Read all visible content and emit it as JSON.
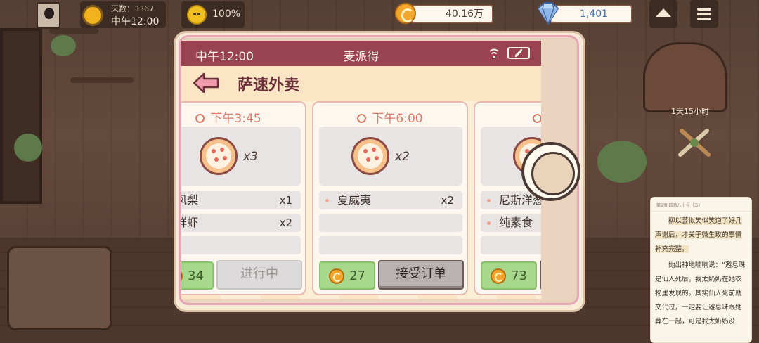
{
  "hud": {
    "day_label": "天数：3367",
    "time_label": "中午12:00",
    "mood_percent": "100%",
    "coins": "40.16万",
    "gems": "1,401"
  },
  "side": {
    "timer_label": "1天15小时"
  },
  "phone": {
    "status_time": "中午12:00",
    "app_title": "麦派得",
    "page_heading": "萨速外卖",
    "orders": [
      {
        "time": "下午3:45",
        "pizza_qty": "x3",
        "items": [
          {
            "name": "凤梨",
            "count": "x1"
          },
          {
            "name": "鲜虾",
            "count": "x2"
          }
        ],
        "reward": "34",
        "action": "进行中",
        "action_state": "in-progress"
      },
      {
        "time": "下午6:00",
        "pizza_qty": "x2",
        "items": [
          {
            "name": "夏威夷",
            "count": "x2"
          }
        ],
        "reward": "27",
        "action": "接受订单",
        "action_state": "available"
      },
      {
        "time": "下午",
        "pizza_qty": "",
        "items": [
          {
            "name": "尼斯洋葱",
            "count": ""
          },
          {
            "name": "纯素食",
            "count": ""
          }
        ],
        "reward": "73",
        "action": "",
        "action_state": "available"
      }
    ]
  },
  "reader": {
    "header": "第2页 四章八十号（五）",
    "paragraphs": [
      "柳以芸似笑似笑道了好几声谢后，才关于微生玫的事情补充完整。",
      "她出神地喃喃说：“避息珠是仙人死后，我太奶奶在她衣物里发现的。其实仙人死前就交代过，一定要让避息珠跟她葬在一起，可是我太奶奶没"
    ]
  },
  "colors": {
    "status_bar": "#9a4350",
    "heading": "#6a2f39",
    "time_accent": "#de7a6a",
    "reward_green": "#a8d88b"
  }
}
